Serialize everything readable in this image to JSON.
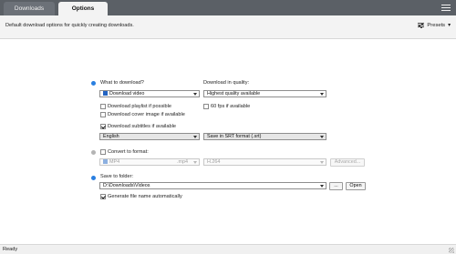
{
  "tabs": [
    {
      "label": "Downloads",
      "active": false
    },
    {
      "label": "Options",
      "active": true
    }
  ],
  "header": {
    "description": "Default download options for quickly creating downloads.",
    "presets_label": "Presets"
  },
  "what_to_download": {
    "label": "What to download?",
    "selected": "Download video",
    "checkboxes": {
      "playlist": {
        "label": "Download playlist if possible",
        "checked": false
      },
      "cover": {
        "label": "Download cover image if available",
        "checked": false
      },
      "subtitles": {
        "label": "Download subtitles if available",
        "checked": true
      }
    },
    "subtitle_language": "English",
    "subtitle_format": "Save in SRT format (.srt)"
  },
  "quality": {
    "label": "Download in quality:",
    "selected": "Highest quality available",
    "fps60": {
      "label": "60 fps if available",
      "checked": false
    }
  },
  "convert": {
    "label": "Convert to format:",
    "checked": false,
    "format": "MP4",
    "extension": ".mp4",
    "codec": "H.264",
    "advanced_label": "Advanced..."
  },
  "save": {
    "label": "Save to folder:",
    "folder": "D:\\Downloads\\Videos",
    "browse_label": "...",
    "open_label": "Open",
    "auto_name": {
      "label": "Generate file name automatically",
      "checked": true
    }
  },
  "status": {
    "text": "Ready"
  },
  "colors": {
    "accent": "#2a7fe0",
    "topbar": "#5b6066"
  }
}
